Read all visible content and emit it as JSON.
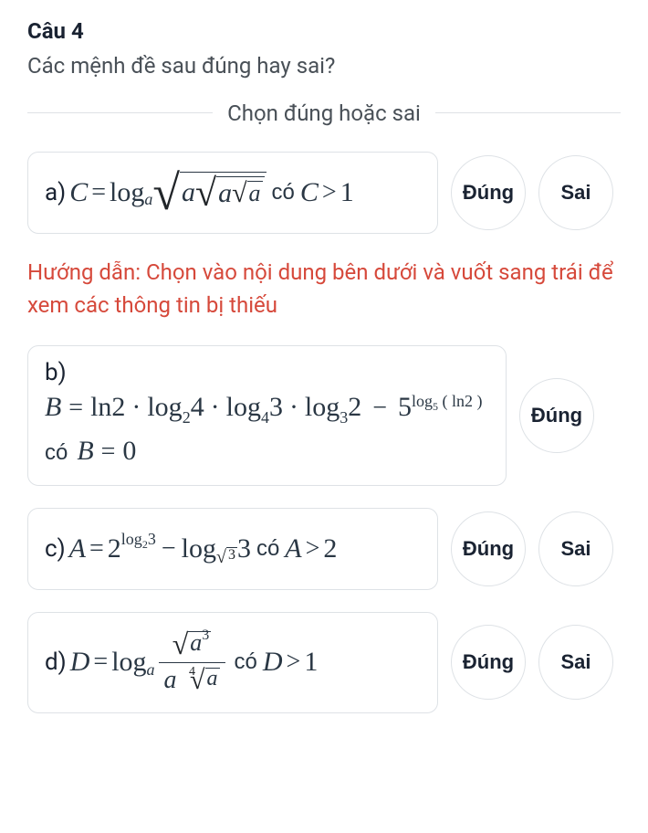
{
  "question": {
    "number_label": "Câu 4",
    "prompt": "Các mệnh đề sau đúng hay sai?"
  },
  "divider_label": "Chọn đúng hoặc sai",
  "hint": "Hướng dẫn: Chọn vào nội dung bên dưới và vuốt sang trái để xem các thông tin bị thiếu",
  "buttons": {
    "true": "Đúng",
    "false": "Sai"
  },
  "items": {
    "a": {
      "label": "a)",
      "expression_text": "C = log_a( sqrt( a * sqrt( a * sqrt(a) ) ) )",
      "condition": "có C > 1",
      "var": "C",
      "cmp": ">",
      "val": "1",
      "has_word": "có"
    },
    "b": {
      "label": "b)",
      "expression_text": "B = ln2 · log_2 4 · log_4 3 · log_3 2 − 5^{log_5(ln2)}",
      "condition": "có B = 0",
      "var": "B",
      "cmp": "=",
      "val": "0",
      "has_word": "có"
    },
    "c": {
      "label": "c)",
      "expression_text": "A = 2^{log_2 3} − log_{√3} 3",
      "condition": "có A > 2",
      "var": "A",
      "cmp": ">",
      "val": "2",
      "has_word": "có"
    },
    "d": {
      "label": "d)",
      "expression_text": "D = log_a( sqrt(a^3) / ( a * 4thRoot(a) ) )",
      "condition": "có D > 1",
      "var": "D",
      "cmp": ">",
      "val": "1",
      "has_word": "có"
    }
  }
}
